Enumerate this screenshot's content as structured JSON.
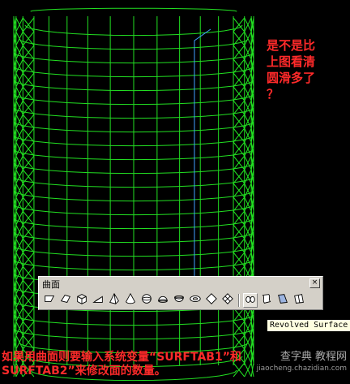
{
  "annotation": {
    "lines": [
      "是不是比",
      "上图看清",
      "圆滑多了",
      "？"
    ]
  },
  "toolbar": {
    "title": "曲面",
    "close_glyph": "×",
    "buttons": [
      {
        "name": "2d-solid-icon"
      },
      {
        "name": "3d-face-icon"
      },
      {
        "name": "box-icon"
      },
      {
        "name": "wedge-icon"
      },
      {
        "name": "pyramid-icon"
      },
      {
        "name": "cone-icon"
      },
      {
        "name": "sphere-icon"
      },
      {
        "name": "dome-icon"
      },
      {
        "name": "dish-icon"
      },
      {
        "name": "torus-icon"
      },
      {
        "name": "mesh-icon"
      },
      {
        "name": "3d-mesh-icon"
      },
      {
        "name": "revolved-surface-icon",
        "active": true
      },
      {
        "name": "tabulated-surface-icon"
      },
      {
        "name": "ruled-surface-icon"
      },
      {
        "name": "edge-surface-icon"
      }
    ]
  },
  "tooltip": "Revolved Surface",
  "caption": {
    "line1": "如果用曲面则要输入系统变量“SURFTAB1”和",
    "line2": "SURFTAB2”来修改面的数量。"
  },
  "watermark": {
    "main": "查字典 教程网",
    "url": "jiaocheng.chazidian.com"
  },
  "colors": {
    "background": "#000000",
    "wireframe": "#22e022",
    "axis_line": "#3fa0ff",
    "annotation": "#ff2a2a",
    "toolbar_bg": "#d4d0c8",
    "tooltip_bg": "#ffffe1"
  }
}
